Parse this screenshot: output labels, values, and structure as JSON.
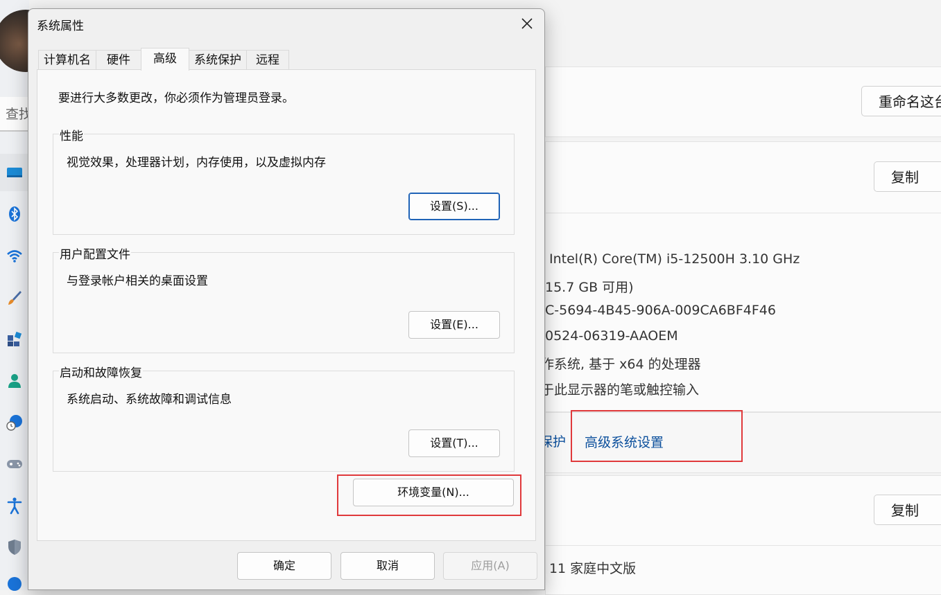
{
  "background_app": {
    "search_placeholder": "查找",
    "rename_button": "重命名这台",
    "copy_button_1": "复制",
    "copy_button_2": "复制",
    "specs": [
      "Intel(R) Core(TM) i5-12500H   3.10 GHz",
      "15.7 GB 可用)",
      "C-5694-4B45-906A-009CA6BF4F46",
      "0524-06319-AAOEM",
      "作系统, 基于 x64 的处理器",
      "于此显示器的笔或触控输入"
    ],
    "protection_link_partial": "保护",
    "advanced_link": "高级系统设置",
    "edition": "s 11 家庭中文版"
  },
  "dialog": {
    "title": "系统属性",
    "tabs": [
      {
        "label": "计算机名"
      },
      {
        "label": "硬件"
      },
      {
        "label": "高级"
      },
      {
        "label": "系统保护"
      },
      {
        "label": "远程"
      }
    ],
    "active_tab": "高级",
    "admin_note": "要进行大多数更改，你必须作为管理员登录。",
    "groups": {
      "performance": {
        "title": "性能",
        "description": "视觉效果，处理器计划，内存使用，以及虚拟内存",
        "button": "设置(S)..."
      },
      "profiles": {
        "title": "用户配置文件",
        "description": "与登录帐户相关的桌面设置",
        "button": "设置(E)..."
      },
      "startup": {
        "title": "启动和故障恢复",
        "description": "系统启动、系统故障和调试信息",
        "button": "设置(T)..."
      }
    },
    "env_button": "环境变量(N)...",
    "ok_button": "确定",
    "cancel_button": "取消",
    "apply_button": "应用(A)"
  },
  "colors": {
    "highlight_box": "#e0393b",
    "link": "#0b4f9c",
    "focus_border": "#1f63b7"
  }
}
